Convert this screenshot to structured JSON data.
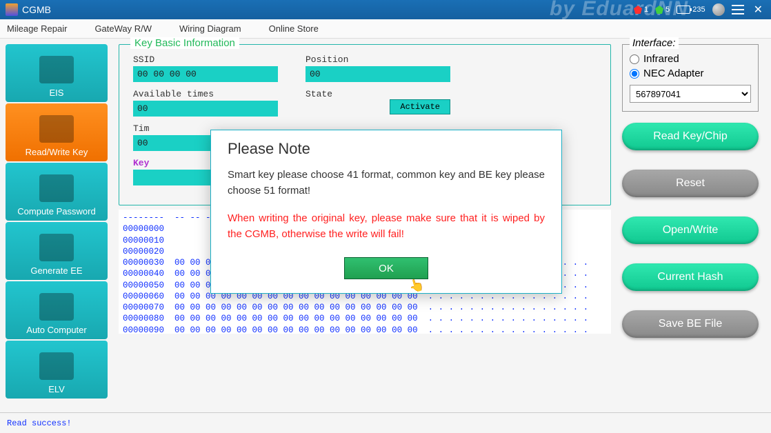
{
  "titlebar": {
    "app_name": "CGMB",
    "watermark": "by EduardNN",
    "gem_red_count": "1",
    "gem_green_count": "5",
    "battery": "235"
  },
  "menu": {
    "items": [
      "Mileage Repair",
      "GateWay R/W",
      "Wiring Diagram",
      "Online Store"
    ]
  },
  "sidebar": {
    "items": [
      {
        "label": "EIS"
      },
      {
        "label": "Read/Write Key"
      },
      {
        "label": "Compute Password"
      },
      {
        "label": "Generate EE"
      },
      {
        "label": "Auto Computer"
      },
      {
        "label": "ELV"
      }
    ],
    "active_index": 1
  },
  "key_info": {
    "legend": "Key Basic Information",
    "ssid_label": "SSID",
    "ssid_value": "00 00 00 00",
    "position_label": "Position",
    "position_value": "00",
    "avail_label": "Available times",
    "avail_value": "00",
    "state_label": "State",
    "activate_btn": "Activate",
    "time_label": "Tim",
    "time_value": "00",
    "key_label": "Key"
  },
  "hexdump": "--------  -- -- -- -- -- -- -- -- -- -- -- -- -- -- -- --\n00000000  \n00000010  \n00000020  \n00000030  00 00 00 00 00 00 00 00 00 00 00 00 00 00 00 00  . . . . . . . . . . . . . . . .\n00000040  00 00 00 00 00 00 00 00 00 00 00 00 00 00 00 00  . . . . . . . . . . . . . . . .\n00000050  00 00 00 00 00 00 00 00 00 00 00 00 00 00 00 00  . . . . . . . . . . . . . . . .\n00000060  00 00 00 00 00 00 00 00 00 00 00 00 00 00 00 00  . . . . . . . . . . . . . . . .\n00000070  00 00 00 00 00 00 00 00 00 00 00 00 00 00 00 00  . . . . . . . . . . . . . . . .\n00000080  00 00 00 00 00 00 00 00 00 00 00 00 00 00 00 00  . . . . . . . . . . . . . . . .\n00000090  00 00 00 00 00 00 00 00 00 00 00 00 00 00 00 00  . . . . . . . . . . . . . . . .",
  "interface": {
    "legend": "Interface:",
    "infrared": "Infrared",
    "nec": "NEC Adapter",
    "selected": "nec",
    "combo_value": "567897041"
  },
  "actions": {
    "read_key": "Read Key/Chip",
    "reset": "Reset",
    "open_write": "Open/Write",
    "current_hash": "Current Hash",
    "save_be": "Save BE File"
  },
  "status": "Read success!",
  "modal": {
    "title": "Please Note",
    "text1": "Smart key please choose 41 format, common key and BE key please choose 51 format!",
    "text2": "When writing the original key, please make sure that it is wiped by the CGMB, otherwise the write will fail!",
    "ok": "OK"
  }
}
